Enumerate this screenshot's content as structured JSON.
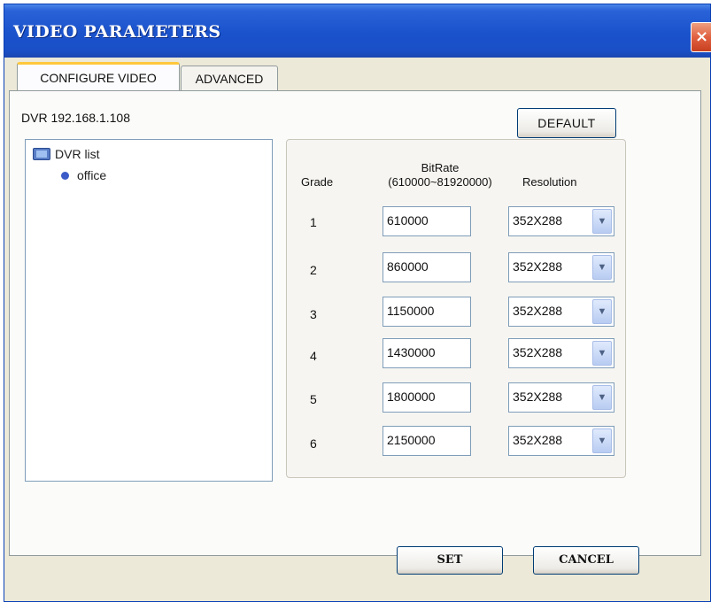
{
  "window": {
    "title": "VIDEO PARAMETERS",
    "close_glyph": "×"
  },
  "tabs": [
    {
      "label": "CONFIGURE VIDEO",
      "active": true
    },
    {
      "label": "ADVANCED",
      "active": false
    }
  ],
  "dvr_label": "DVR 192.168.1.108",
  "buttons": {
    "default": "DEFAULT",
    "set": "SET",
    "cancel": "CANCEL"
  },
  "tree": {
    "root": {
      "label": "DVR list",
      "icon": "monitor-icon"
    },
    "children": [
      {
        "label": "office",
        "icon": "dot-icon"
      }
    ]
  },
  "grid": {
    "headers": {
      "grade": "Grade",
      "bitrate_line1": "BitRate",
      "bitrate_line2": "(610000~81920000)",
      "resolution": "Resolution"
    },
    "rows": [
      {
        "grade": "1",
        "bitrate": "610000",
        "resolution": "352X288"
      },
      {
        "grade": "2",
        "bitrate": "860000",
        "resolution": "352X288"
      },
      {
        "grade": "3",
        "bitrate": "1150000",
        "resolution": "352X288"
      },
      {
        "grade": "4",
        "bitrate": "1430000",
        "resolution": "352X288"
      },
      {
        "grade": "5",
        "bitrate": "1800000",
        "resolution": "352X288"
      },
      {
        "grade": "6",
        "bitrate": "2150000",
        "resolution": "352X288"
      }
    ]
  },
  "colors": {
    "titlebar": "#1a52cc",
    "window_bg": "#ece9d8",
    "tab_accent": "#ffc83c"
  }
}
